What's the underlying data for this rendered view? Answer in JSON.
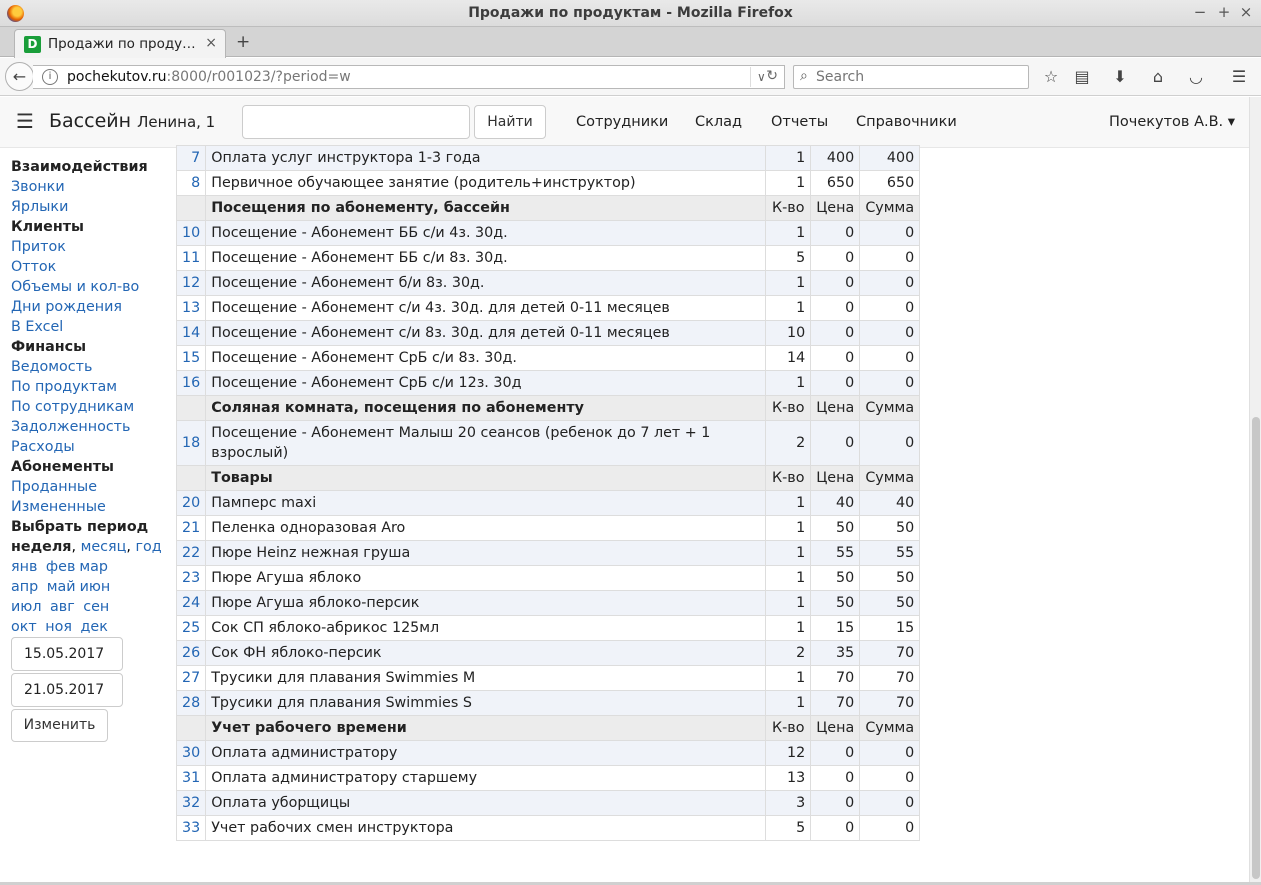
{
  "window": {
    "title": "Продажи по продуктам - Mozilla Firefox"
  },
  "tab": {
    "label": "Продажи по проду…",
    "favicon_letter": "D"
  },
  "address": {
    "host": "pochekutov.ru",
    "rest": ":8000/r001023/?period=w"
  },
  "search": {
    "placeholder": "Search"
  },
  "header": {
    "brand": "Бассейн",
    "brand_sub": "Ленина, 1",
    "find_label": "Найти",
    "menu": [
      "Сотрудники",
      "Склад",
      "Отчеты",
      "Справочники"
    ],
    "user": "Почекутов А.В. ▾"
  },
  "sidebar": {
    "sections": [
      {
        "title": "Взаимодействия",
        "links": [
          "Звонки",
          "Ярлыки"
        ]
      },
      {
        "title": "Клиенты",
        "links": [
          "Приток",
          "Отток",
          "Объемы и кол-во",
          "Дни рождения",
          "В Excel"
        ]
      },
      {
        "title": "Финансы",
        "links": [
          "Ведомость",
          "По продуктам",
          "По сотрудникам",
          "Задолженность",
          "Расходы"
        ]
      },
      {
        "title": "Абонементы",
        "links": [
          "Проданные",
          "Измененные"
        ]
      }
    ],
    "period_title": "Выбрать период",
    "period_current": "неделя",
    "period_month": "месяц",
    "period_year": "год",
    "months": [
      [
        "янв",
        "фев",
        "мар"
      ],
      [
        "апр",
        "май",
        "июн"
      ],
      [
        "июл",
        "авг",
        "сен"
      ],
      [
        "окт",
        "ноя",
        "дек"
      ]
    ],
    "date_from": "15.05.2017",
    "date_to": "21.05.2017",
    "change_label": "Изменить"
  },
  "table": {
    "rows": [
      {
        "type": "item",
        "num": "7",
        "name": "Оплата услуг инструктора 1-3 года",
        "qty": "1",
        "price": "400",
        "sum": "400"
      },
      {
        "type": "item",
        "num": "8",
        "name": "Первичное обучающее занятие (родитель+инструктор)",
        "qty": "1",
        "price": "650",
        "sum": "650"
      },
      {
        "type": "group",
        "name": "Посещения по абонементу, бассейн",
        "qty": "К-во",
        "price": "Цена",
        "sum": "Сумма"
      },
      {
        "type": "item",
        "num": "10",
        "name": "Посещение - Абонемент ББ с/и 4з. 30д.",
        "qty": "1",
        "price": "0",
        "sum": "0"
      },
      {
        "type": "item",
        "num": "11",
        "name": "Посещение - Абонемент ББ с/и 8з. 30д.",
        "qty": "5",
        "price": "0",
        "sum": "0"
      },
      {
        "type": "item",
        "num": "12",
        "name": "Посещение - Абонемент б/и 8з. 30д.",
        "qty": "1",
        "price": "0",
        "sum": "0"
      },
      {
        "type": "item",
        "num": "13",
        "name": "Посещение - Абонемент с/и 4з. 30д. для детей 0-11 месяцев",
        "qty": "1",
        "price": "0",
        "sum": "0"
      },
      {
        "type": "item",
        "num": "14",
        "name": "Посещение - Абонемент с/и 8з. 30д. для детей 0-11 месяцев",
        "qty": "10",
        "price": "0",
        "sum": "0"
      },
      {
        "type": "item",
        "num": "15",
        "name": "Посещение - Абонемент СрБ с/и 8з. 30д.",
        "qty": "14",
        "price": "0",
        "sum": "0"
      },
      {
        "type": "item",
        "num": "16",
        "name": "Посещение - Абонемент СрБ с/и 12з. 30д",
        "qty": "1",
        "price": "0",
        "sum": "0"
      },
      {
        "type": "group",
        "name": "Соляная комната, посещения по абонементу",
        "qty": "К-во",
        "price": "Цена",
        "sum": "Сумма"
      },
      {
        "type": "item",
        "num": "18",
        "name": "Посещение - Абонемент Малыш 20 сеансов (ребенок до 7 лет + 1 взрослый)",
        "qty": "2",
        "price": "0",
        "sum": "0",
        "tall": true
      },
      {
        "type": "group",
        "name": "Товары",
        "qty": "К-во",
        "price": "Цена",
        "sum": "Сумма"
      },
      {
        "type": "item",
        "num": "20",
        "name": "Памперс maxi",
        "qty": "1",
        "price": "40",
        "sum": "40"
      },
      {
        "type": "item",
        "num": "21",
        "name": "Пеленка одноразовая Aro",
        "qty": "1",
        "price": "50",
        "sum": "50"
      },
      {
        "type": "item",
        "num": "22",
        "name": "Пюре Heinz нежная груша",
        "qty": "1",
        "price": "55",
        "sum": "55"
      },
      {
        "type": "item",
        "num": "23",
        "name": "Пюре Агуша яблоко",
        "qty": "1",
        "price": "50",
        "sum": "50"
      },
      {
        "type": "item",
        "num": "24",
        "name": "Пюре Агуша яблоко-персик",
        "qty": "1",
        "price": "50",
        "sum": "50"
      },
      {
        "type": "item",
        "num": "25",
        "name": "Сок СП яблоко-абрикос 125мл",
        "qty": "1",
        "price": "15",
        "sum": "15"
      },
      {
        "type": "item",
        "num": "26",
        "name": "Сок ФН яблоко-персик",
        "qty": "2",
        "price": "35",
        "sum": "70"
      },
      {
        "type": "item",
        "num": "27",
        "name": "Трусики для плавания Swimmies M",
        "qty": "1",
        "price": "70",
        "sum": "70"
      },
      {
        "type": "item",
        "num": "28",
        "name": "Трусики для плавания Swimmies S",
        "qty": "1",
        "price": "70",
        "sum": "70"
      },
      {
        "type": "group",
        "name": "Учет рабочего времени",
        "qty": "К-во",
        "price": "Цена",
        "sum": "Сумма"
      },
      {
        "type": "item",
        "num": "30",
        "name": "Оплата администратору",
        "qty": "12",
        "price": "0",
        "sum": "0"
      },
      {
        "type": "item",
        "num": "31",
        "name": "Оплата администратору старшему",
        "qty": "13",
        "price": "0",
        "sum": "0"
      },
      {
        "type": "item",
        "num": "32",
        "name": "Оплата уборщицы",
        "qty": "3",
        "price": "0",
        "sum": "0"
      },
      {
        "type": "item",
        "num": "33",
        "name": "Учет рабочих смен инструктора",
        "qty": "5",
        "price": "0",
        "sum": "0"
      }
    ]
  }
}
